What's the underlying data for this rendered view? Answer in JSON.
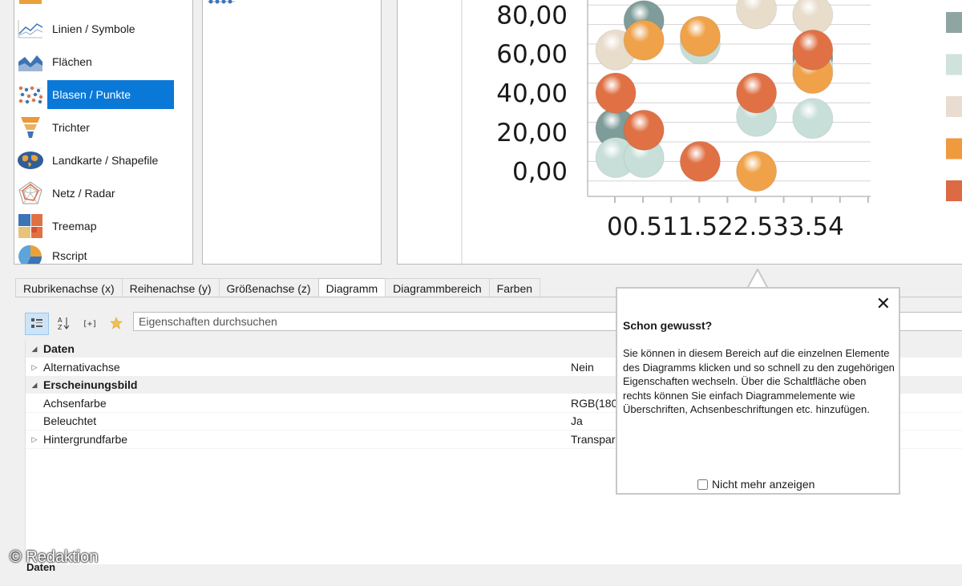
{
  "chart_types": [
    {
      "label": "",
      "icon": "bar-chart-icon"
    },
    {
      "label": "Linien / Symbole",
      "icon": "line-chart-icon"
    },
    {
      "label": "Flächen",
      "icon": "area-chart-icon"
    },
    {
      "label": "Blasen / Punkte",
      "icon": "bubble-chart-icon",
      "selected": true
    },
    {
      "label": "Trichter",
      "icon": "funnel-chart-icon"
    },
    {
      "label": "Landkarte / Shapefile",
      "icon": "map-chart-icon"
    },
    {
      "label": "Netz / Radar",
      "icon": "radar-chart-icon"
    },
    {
      "label": "Treemap",
      "icon": "treemap-chart-icon"
    },
    {
      "label": "Rscript",
      "icon": "rscript-chart-icon"
    }
  ],
  "chart_data": {
    "type": "scatter",
    "y_tick_labels": [
      "0,00",
      "20,00",
      "40,00",
      "60,00",
      "80,00"
    ],
    "x_axis_text": "00.511.522.533.54",
    "ylim": [
      -10,
      90
    ],
    "xlim": [
      0,
      5
    ],
    "grid": true,
    "series": [
      {
        "color": "#7e9c99",
        "points": [
          [
            0.5,
            22
          ],
          [
            1,
            77
          ],
          [
            4,
            58
          ]
        ]
      },
      {
        "color": "#c8dfd9",
        "points": [
          [
            0.5,
            7
          ],
          [
            1,
            7
          ],
          [
            2,
            65
          ],
          [
            3,
            28
          ],
          [
            4,
            27
          ],
          [
            4,
            53
          ]
        ]
      },
      {
        "color": "#e8dccb",
        "points": [
          [
            0.5,
            62
          ],
          [
            3,
            83
          ],
          [
            4,
            80
          ]
        ]
      },
      {
        "color": "#f0a24a",
        "points": [
          [
            1,
            67
          ],
          [
            2,
            69
          ],
          [
            3,
            0
          ],
          [
            4,
            50
          ]
        ]
      },
      {
        "color": "#e07145",
        "points": [
          [
            0.5,
            40
          ],
          [
            1,
            21
          ],
          [
            2,
            5
          ],
          [
            3,
            40
          ],
          [
            4,
            62
          ]
        ]
      }
    ]
  },
  "legend_colors": [
    "#8fa5a2",
    "#cfe2dc",
    "#e8ddd0",
    "#f09a3e",
    "#dc6a45"
  ],
  "tabs": [
    "Rubrikenachse (x)",
    "Reihenachse (y)",
    "Größenachse (z)",
    "Diagramm",
    "Diagrammbereich",
    "Farben"
  ],
  "active_tab": "Diagramm",
  "toolbar": {
    "search_placeholder": "Eigenschaften durchsuchen",
    "icons": [
      "categorized-icon",
      "sort-az-icon",
      "add-property-icon",
      "favorite-star-icon"
    ]
  },
  "grid": {
    "rows": [
      {
        "kind": "category",
        "name": "Daten"
      },
      {
        "kind": "property",
        "name": "Alternativachse",
        "value": "Nein",
        "expandable": true
      },
      {
        "kind": "category",
        "name": "Erscheinungsbild"
      },
      {
        "kind": "property",
        "name": "Achsenfarbe",
        "value": "RGB(180"
      },
      {
        "kind": "property",
        "name": "Beleuchtet",
        "value": "Ja"
      },
      {
        "kind": "property",
        "name": "Hintergrundfarbe",
        "value": "Transpar",
        "expandable": true
      }
    ],
    "description_title": "Daten"
  },
  "tooltip": {
    "title": "Schon gewusst?",
    "body": "Sie können in diesem Bereich auf die einzelnen Elemente des Diagramms klicken und so schnell zu den zugehörigen Eigenschaften wechseln. Über die Schaltfläche oben rechts können Sie einfach Diagrammelemente wie Überschriften, Achsenbeschriftungen etc. hinzufügen.",
    "checkbox_label": "Nicht mehr anzeigen",
    "close_glyph": "✕"
  },
  "watermark": "© Redaktion"
}
